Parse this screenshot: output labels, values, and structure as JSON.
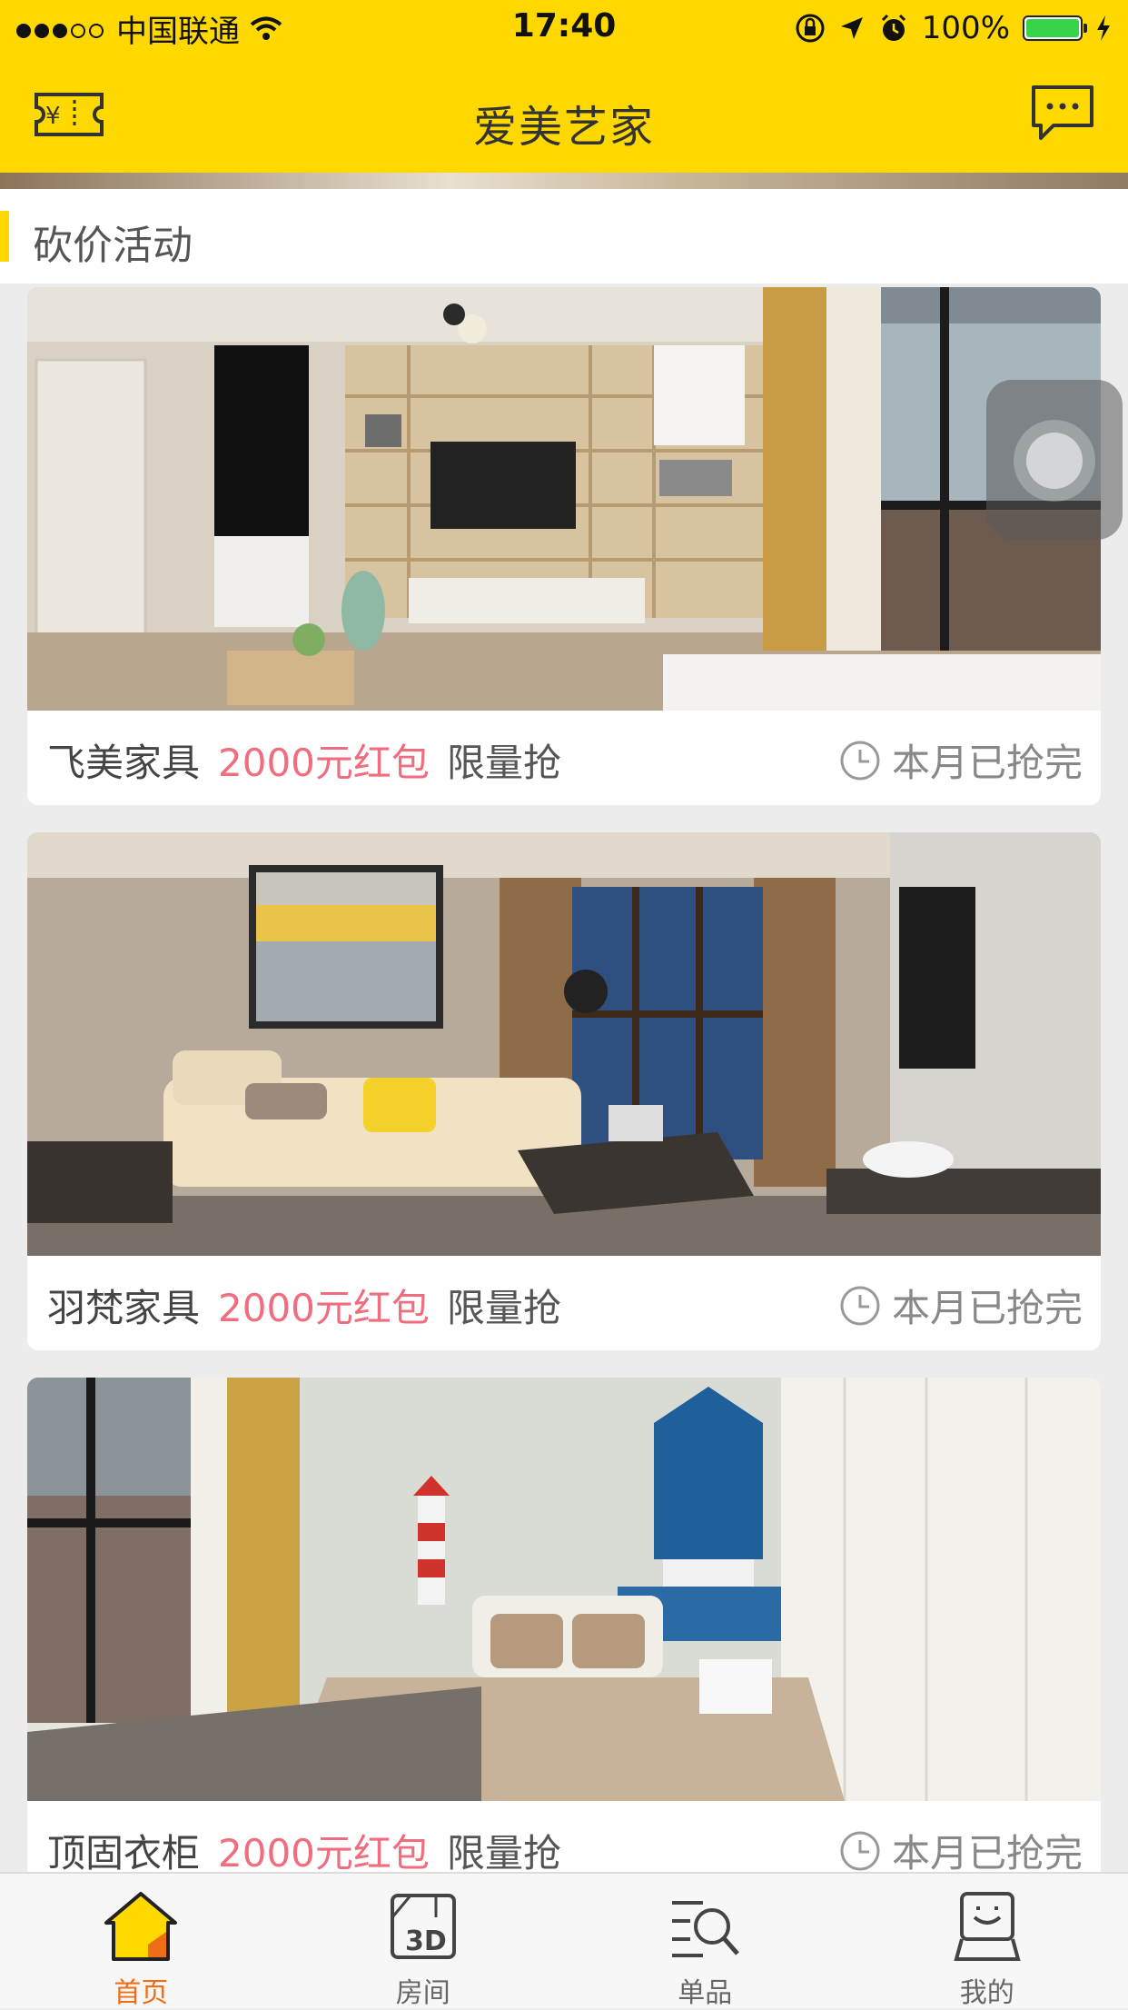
{
  "status_bar": {
    "carrier": "中国联通",
    "time": "17:40",
    "battery": "100%"
  },
  "nav": {
    "title": "爱美艺家",
    "left_icon": "coupon-icon",
    "right_icon": "message-icon"
  },
  "section": {
    "title": "砍价活动"
  },
  "cards": [
    {
      "shop": "飞美家具",
      "promo": "2000元红包",
      "limit": "限量抢",
      "status": "本月已抢完"
    },
    {
      "shop": "羽梵家具",
      "promo": "2000元红包",
      "limit": "限量抢",
      "status": "本月已抢完"
    },
    {
      "shop": "顶固衣柜",
      "promo": "2000元红包",
      "limit": "限量抢",
      "status": "本月已抢完"
    }
  ],
  "tabs": [
    {
      "label": "首页",
      "icon": "home-icon",
      "active": true
    },
    {
      "label": "房间",
      "icon": "room-3d-icon",
      "active": false
    },
    {
      "label": "单品",
      "icon": "search-list-icon",
      "active": false
    },
    {
      "label": "我的",
      "icon": "profile-icon",
      "active": false
    }
  ],
  "colors": {
    "brand_yellow": "#ffd800",
    "promo_pink": "#f06d7f",
    "active_tab": "#f06d17"
  }
}
